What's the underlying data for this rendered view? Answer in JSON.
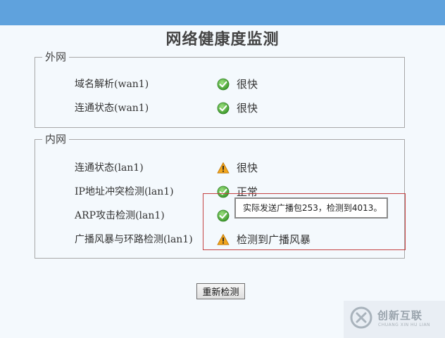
{
  "page": {
    "title": "网络健康度监测",
    "recheck_label": "重新检测"
  },
  "wan": {
    "legend": "外网",
    "items": [
      {
        "label": "域名解析(wan1)",
        "status": "很快",
        "icon": "check-icon"
      },
      {
        "label": "连通状态(wan1)",
        "status": "很快",
        "icon": "check-icon"
      }
    ]
  },
  "lan": {
    "legend": "内网",
    "items": [
      {
        "label": "连通状态(lan1)",
        "status": "很快",
        "icon": "warning-icon"
      },
      {
        "label": "IP地址冲突检测(lan1)",
        "status": "正常",
        "icon": "check-icon"
      },
      {
        "label": "ARP攻击检测(lan1)",
        "status": "",
        "icon": "check-icon"
      },
      {
        "label": "广播风暴与环路检测(lan1)",
        "status": "检测到广播风暴",
        "icon": "warning-icon"
      }
    ]
  },
  "tooltip": {
    "text": "实际发送广播包253，检测到4013。"
  },
  "watermark": {
    "main": "创新互联",
    "sub": "CHUANG XIN HU LIAN"
  },
  "colors": {
    "top_bar": "#5fa2dd",
    "background": "#f4f9fd",
    "ok": "#4caf3a",
    "warning": "#f2a51c",
    "highlight_border": "#c44343"
  }
}
